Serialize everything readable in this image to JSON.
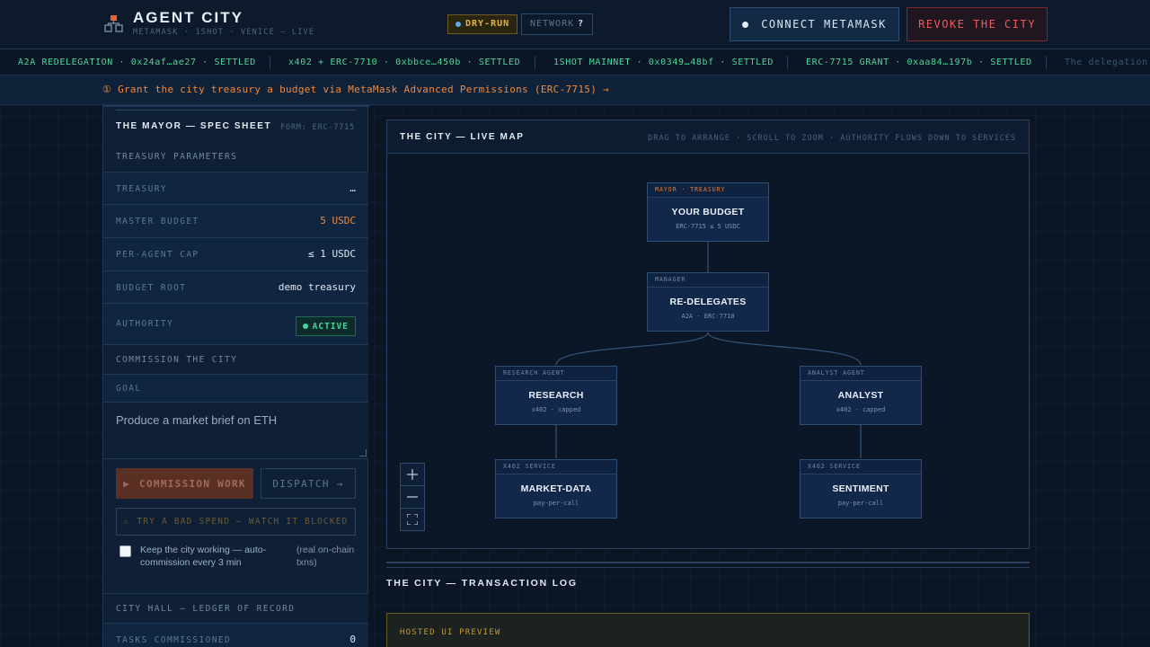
{
  "header": {
    "title": "AGENT CITY",
    "subtitle": "METAMASK · 1SHOT · VENICE — LIVE",
    "dry_run": "DRY-RUN",
    "network_label": "NETWORK",
    "network_value": "?",
    "connect_label": "CONNECT METAMASK",
    "revoke_label": "REVOKE THE CITY",
    "colors": {
      "accent_orange": "#f0883a",
      "revoke_red": "#ef5a5f",
      "settled_green": "#4fd49a"
    }
  },
  "ticker": {
    "items": [
      "A2A REDELEGATION · 0x24af…ae27 · SETTLED",
      "x402 + ERC-7710 · 0xbbce…450b · SETTLED",
      "1SHOT MAINNET · 0x0349…48bf · SETTLED",
      "ERC-7715 GRANT · 0xaa84…197b · SETTLED",
      "The delegation"
    ]
  },
  "banner": {
    "text": "① Grant the city treasury a budget via MetaMask Advanced Permissions (ERC-7715) →"
  },
  "spec": {
    "title": "THE MAYOR — SPEC SHEET",
    "form": "FORM: ERC-7715",
    "treasury_section": "TREASURY PARAMETERS",
    "rows": [
      {
        "k": "TREASURY",
        "v": "…"
      },
      {
        "k": "MASTER BUDGET",
        "v": "5 USDC"
      },
      {
        "k": "PER-AGENT CAP",
        "v": "≤ 1 USDC"
      },
      {
        "k": "BUDGET ROOT",
        "v": "demo treasury"
      },
      {
        "k": "AUTHORITY",
        "v": "ACTIVE"
      }
    ],
    "commission_section": "COMMISSION THE CITY",
    "goal_label": "GOAL",
    "goal_placeholder": "Produce a market brief on ETH",
    "commission_btn": "COMMISSION WORK",
    "dispatch_btn": "DISPATCH →",
    "bad_spend_btn": "TRY A BAD SPEND — WATCH IT BLOCKED",
    "keep_working": "Keep the city working — auto-commission every 3 min",
    "keep_working_note": "(real on-chain txns)",
    "hall_section": "CITY HALL — LEDGER OF RECORD",
    "tasks_label": "TASKS COMMISSIONED",
    "tasks_value": "0"
  },
  "map": {
    "title": "THE CITY — LIVE MAP",
    "hint": "DRAG TO ARRANGE · SCROLL TO ZOOM · AUTHORITY FLOWS DOWN TO SERVICES",
    "nodes": [
      {
        "header": "MAYOR · TREASURY",
        "title": "YOUR BUDGET",
        "sub": "ERC-7715 ≤ 5 USDC"
      },
      {
        "header": "MANAGER",
        "title": "RE-DELEGATES",
        "sub": "A2A · ERC-7710"
      },
      {
        "header": "RESEARCH AGENT",
        "title": "RESEARCH",
        "sub": "x402 · capped"
      },
      {
        "header": "ANALYST AGENT",
        "title": "ANALYST",
        "sub": "x402 · capped"
      },
      {
        "header": "X402 SERVICE",
        "title": "MARKET-DATA",
        "sub": "pay-per-call"
      },
      {
        "header": "X402 SERVICE",
        "title": "SENTIMENT",
        "sub": "pay-per-call"
      }
    ]
  },
  "log": {
    "title": "THE CITY — TRANSACTION LOG",
    "hosted": "HOSTED UI PREVIEW"
  }
}
